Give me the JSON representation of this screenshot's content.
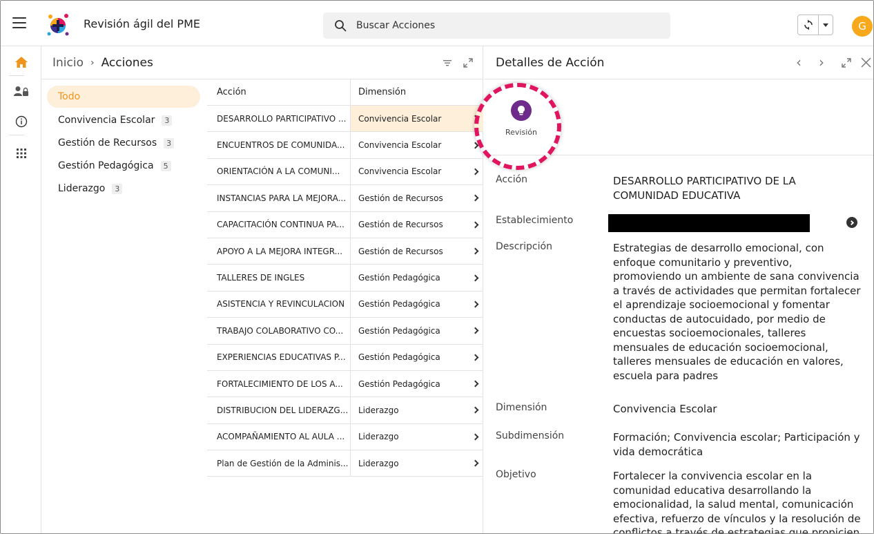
{
  "app": {
    "title": "Revisión ágil del PME",
    "avatar_initial": "G",
    "avatar_color": "#f7a81b",
    "accent_color": "#f0941d",
    "highlight_color": "#e0145f"
  },
  "search": {
    "placeholder": "Buscar Acciones"
  },
  "rail": {
    "items": [
      "home-icon",
      "user-lock-icon",
      "info-icon",
      "apps-grid-icon"
    ]
  },
  "breadcrumb": {
    "root": "Inicio",
    "separator": "›",
    "current": "Acciones"
  },
  "filters": [
    {
      "label": "Todo",
      "count": ""
    },
    {
      "label": "Convivencia Escolar",
      "count": "3"
    },
    {
      "label": "Gestión de Recursos",
      "count": "3"
    },
    {
      "label": "Gestión Pedagógica",
      "count": "5"
    },
    {
      "label": "Liderazgo",
      "count": "3"
    }
  ],
  "table": {
    "headers": {
      "accion": "Acción",
      "dimension": "Dimensión"
    },
    "rows": [
      {
        "accion": "DESARROLLO PARTICIPATIVO ...",
        "dimension": "Convivencia Escolar"
      },
      {
        "accion": "ENCUENTROS DE COMUNIDA...",
        "dimension": "Convivencia Escolar"
      },
      {
        "accion": "ORIENTACIÓN A LA COMUNI...",
        "dimension": "Convivencia Escolar"
      },
      {
        "accion": "INSTANCIAS PARA LA MEJORA...",
        "dimension": "Gestión de Recursos"
      },
      {
        "accion": "CAPACITACIÓN CONTINUA PA...",
        "dimension": "Gestión de Recursos"
      },
      {
        "accion": "APOYO A LA MEJORA INTEGR...",
        "dimension": "Gestión de Recursos"
      },
      {
        "accion": "TALLERES DE INGLES",
        "dimension": "Gestión Pedagógica"
      },
      {
        "accion": "ASISTENCIA Y REVINCULACION",
        "dimension": "Gestión Pedagógica"
      },
      {
        "accion": "TRABAJO COLABORATIVO CO...",
        "dimension": "Gestión Pedagógica"
      },
      {
        "accion": "EXPERIENCIAS EDUCATIVAS P...",
        "dimension": "Gestión Pedagógica"
      },
      {
        "accion": "FORTALECIMIENTO DE LOS A...",
        "dimension": "Gestión Pedagógica"
      },
      {
        "accion": "DISTRIBUCION DEL LIDERAZG...",
        "dimension": "Liderazgo"
      },
      {
        "accion": "ACOMPAÑAMIENTO AL AULA ...",
        "dimension": "Liderazgo"
      },
      {
        "accion": "Plan de Gestión de la Adminis...",
        "dimension": "Liderazgo"
      }
    ]
  },
  "detail": {
    "title": "Detalles de Acción",
    "revision_label": "Revisión",
    "fields": {
      "accion_label": "Acción",
      "accion_value": "DESARROLLO PARTICIPATIVO DE LA COMUNIDAD EDUCATIVA",
      "establecimiento_label": "Establecimiento",
      "descripcion_label": "Descripción",
      "descripcion_value": "Estrategias de desarrollo emocional, con enfoque comunitario y preventivo, promoviendo un ambiente de sana convivencia a través de actividades que permitan fortalecer el aprendizaje socioemocional y fomentar conductas de autocuidado, por medio de encuestas socioemocionales, talleres mensuales de educación socioemocional, talleres mensuales de educación en valores, escuela para padres",
      "dimension_label": "Dimensión",
      "dimension_value": "Convivencia Escolar",
      "subdimension_label": "Subdimensión",
      "subdimension_value": "Formación; Convivencia escolar; Participación y vida democrática",
      "objetivo_label": "Objetivo",
      "objetivo_value": "Fortalecer la convivencia escolar en la comunidad educativa desarrollando la emocionalidad, la salud mental, comunicación efectiva, refuerzo de vínculos y la resolución de conflictos a través de estrategias que propicien"
    }
  }
}
